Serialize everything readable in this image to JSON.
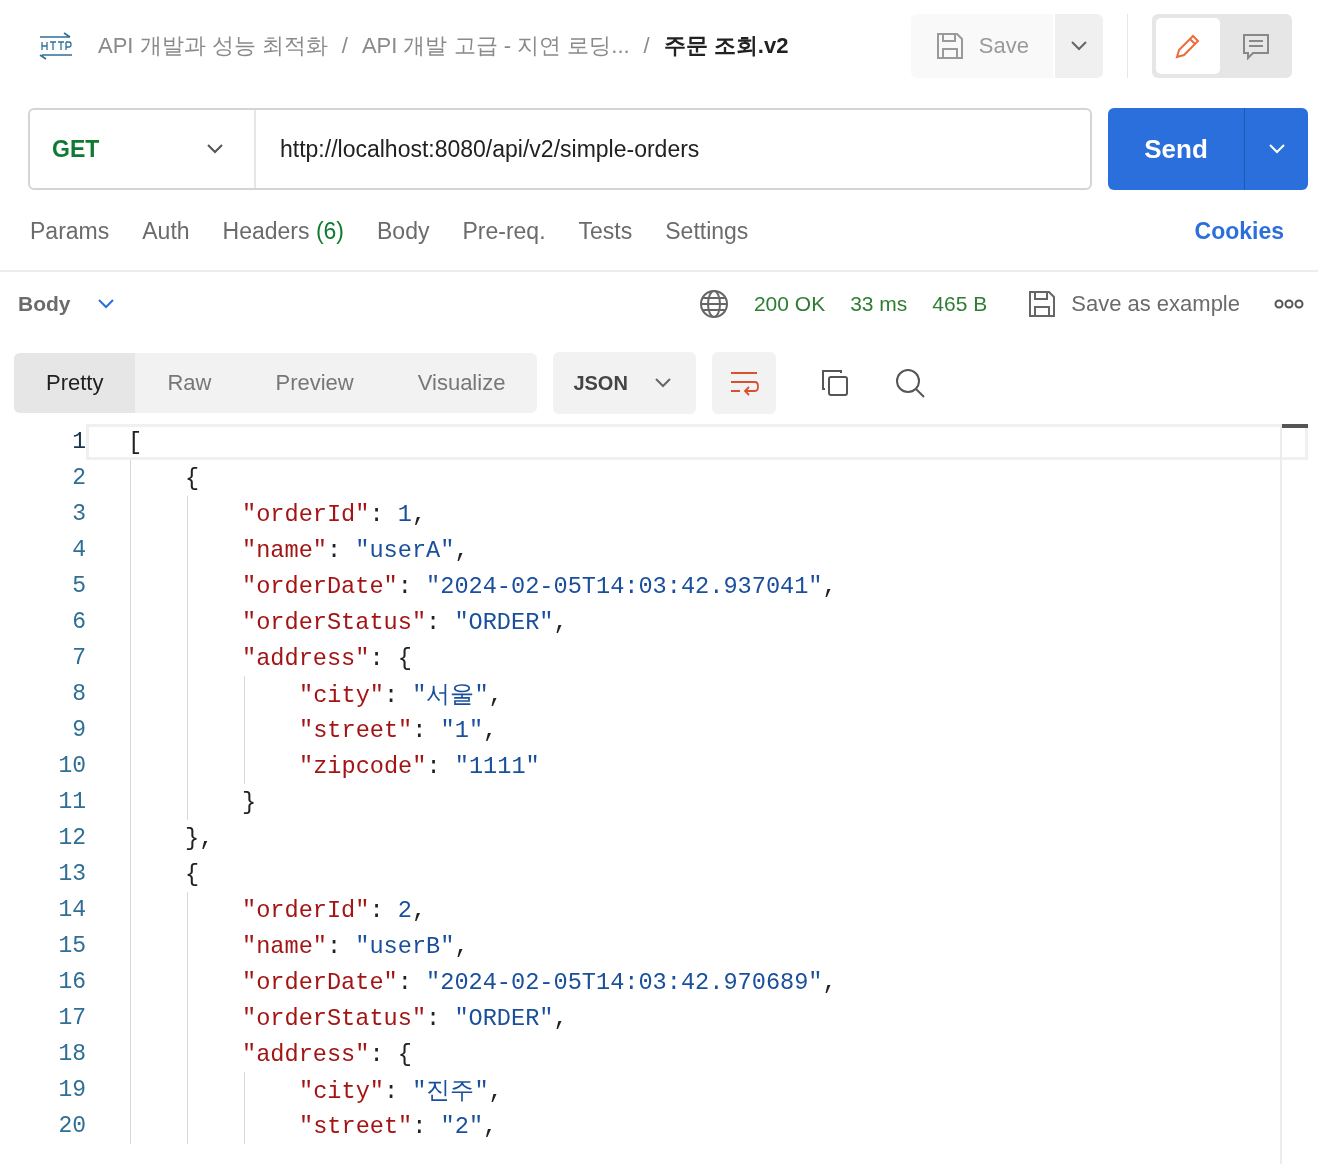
{
  "header": {
    "breadcrumbs": [
      {
        "label": "API 개발과 성능 최적화",
        "current": false
      },
      {
        "label": "API 개발 고급 - 지연 로딩...",
        "current": false
      },
      {
        "label": "주문 조회.v2",
        "current": true
      }
    ],
    "separator": "/",
    "save_button": "Save",
    "modes": [
      {
        "kind": "edit",
        "selected": true
      },
      {
        "kind": "comments",
        "selected": false
      }
    ]
  },
  "request": {
    "method": "GET",
    "url": "http://localhost:8080/api/v2/simple-orders",
    "send_button": "Send"
  },
  "request_tabs": [
    {
      "label": "Params"
    },
    {
      "label": "Auth"
    },
    {
      "label": "Headers",
      "count": "(6)"
    },
    {
      "label": "Body"
    },
    {
      "label": "Pre-req."
    },
    {
      "label": "Tests"
    },
    {
      "label": "Settings"
    }
  ],
  "cookies_link": "Cookies",
  "response": {
    "section": "Body",
    "status": "200 OK",
    "time": "33 ms",
    "size": "465 B",
    "save_example": "Save as example",
    "view_tabs": [
      {
        "label": "Pretty",
        "selected": true
      },
      {
        "label": "Raw",
        "selected": false
      },
      {
        "label": "Preview",
        "selected": false
      },
      {
        "label": "Visualize",
        "selected": false
      }
    ],
    "format": "JSON",
    "lines": [
      {
        "number": "1",
        "selected": true,
        "tokens": [
          {
            "kind": "punct",
            "text": "["
          }
        ]
      },
      {
        "number": "2",
        "selected": false,
        "tokens": [
          {
            "kind": "punct",
            "text": "{"
          }
        ]
      },
      {
        "number": "3",
        "selected": false,
        "tokens": [
          {
            "kind": "key",
            "text": "\"orderId\""
          },
          {
            "kind": "punct",
            "text": ": "
          },
          {
            "kind": "number",
            "text": "1"
          },
          {
            "kind": "punct",
            "text": ","
          }
        ]
      },
      {
        "number": "4",
        "selected": false,
        "tokens": [
          {
            "kind": "key",
            "text": "\"name\""
          },
          {
            "kind": "punct",
            "text": ": "
          },
          {
            "kind": "string",
            "text": "\"userA\""
          },
          {
            "kind": "punct",
            "text": ","
          }
        ]
      },
      {
        "number": "5",
        "selected": false,
        "tokens": [
          {
            "kind": "key",
            "text": "\"orderDate\""
          },
          {
            "kind": "punct",
            "text": ": "
          },
          {
            "kind": "string",
            "text": "\"2024-02-05T14:03:42.937041\""
          },
          {
            "kind": "punct",
            "text": ","
          }
        ]
      },
      {
        "number": "6",
        "selected": false,
        "tokens": [
          {
            "kind": "key",
            "text": "\"orderStatus\""
          },
          {
            "kind": "punct",
            "text": ": "
          },
          {
            "kind": "string",
            "text": "\"ORDER\""
          },
          {
            "kind": "punct",
            "text": ","
          }
        ]
      },
      {
        "number": "7",
        "selected": false,
        "tokens": [
          {
            "kind": "key",
            "text": "\"address\""
          },
          {
            "kind": "punct",
            "text": ": {"
          }
        ]
      },
      {
        "number": "8",
        "selected": false,
        "tokens": [
          {
            "kind": "key",
            "text": "\"city\""
          },
          {
            "kind": "punct",
            "text": ": "
          },
          {
            "kind": "string",
            "text": "\"서울\""
          },
          {
            "kind": "punct",
            "text": ","
          }
        ]
      },
      {
        "number": "9",
        "selected": false,
        "tokens": [
          {
            "kind": "key",
            "text": "\"street\""
          },
          {
            "kind": "punct",
            "text": ": "
          },
          {
            "kind": "string",
            "text": "\"1\""
          },
          {
            "kind": "punct",
            "text": ","
          }
        ]
      },
      {
        "number": "10",
        "selected": false,
        "tokens": [
          {
            "kind": "key",
            "text": "\"zipcode\""
          },
          {
            "kind": "punct",
            "text": ": "
          },
          {
            "kind": "string",
            "text": "\"1111\""
          }
        ]
      },
      {
        "number": "11",
        "selected": false,
        "tokens": [
          {
            "kind": "punct",
            "text": "}"
          }
        ]
      },
      {
        "number": "12",
        "selected": false,
        "tokens": [
          {
            "kind": "punct",
            "text": "},"
          }
        ]
      },
      {
        "number": "13",
        "selected": false,
        "tokens": [
          {
            "kind": "punct",
            "text": "{"
          }
        ]
      },
      {
        "number": "14",
        "selected": false,
        "tokens": [
          {
            "kind": "key",
            "text": "\"orderId\""
          },
          {
            "kind": "punct",
            "text": ": "
          },
          {
            "kind": "number",
            "text": "2"
          },
          {
            "kind": "punct",
            "text": ","
          }
        ]
      },
      {
        "number": "15",
        "selected": false,
        "tokens": [
          {
            "kind": "key",
            "text": "\"name\""
          },
          {
            "kind": "punct",
            "text": ": "
          },
          {
            "kind": "string",
            "text": "\"userB\""
          },
          {
            "kind": "punct",
            "text": ","
          }
        ]
      },
      {
        "number": "16",
        "selected": false,
        "tokens": [
          {
            "kind": "key",
            "text": "\"orderDate\""
          },
          {
            "kind": "punct",
            "text": ": "
          },
          {
            "kind": "string",
            "text": "\"2024-02-05T14:03:42.970689\""
          },
          {
            "kind": "punct",
            "text": ","
          }
        ]
      },
      {
        "number": "17",
        "selected": false,
        "tokens": [
          {
            "kind": "key",
            "text": "\"orderStatus\""
          },
          {
            "kind": "punct",
            "text": ": "
          },
          {
            "kind": "string",
            "text": "\"ORDER\""
          },
          {
            "kind": "punct",
            "text": ","
          }
        ]
      },
      {
        "number": "18",
        "selected": false,
        "tokens": [
          {
            "kind": "key",
            "text": "\"address\""
          },
          {
            "kind": "punct",
            "text": ": {"
          }
        ]
      },
      {
        "number": "19",
        "selected": false,
        "tokens": [
          {
            "kind": "key",
            "text": "\"city\""
          },
          {
            "kind": "punct",
            "text": ": "
          },
          {
            "kind": "string",
            "text": "\"진주\""
          },
          {
            "kind": "punct",
            "text": ","
          }
        ]
      },
      {
        "number": "20",
        "selected": false,
        "tokens": [
          {
            "kind": "key",
            "text": "\"street\""
          },
          {
            "kind": "punct",
            "text": ": "
          },
          {
            "kind": "string",
            "text": "\"2\""
          },
          {
            "kind": "punct",
            "text": ","
          }
        ]
      }
    ]
  }
}
